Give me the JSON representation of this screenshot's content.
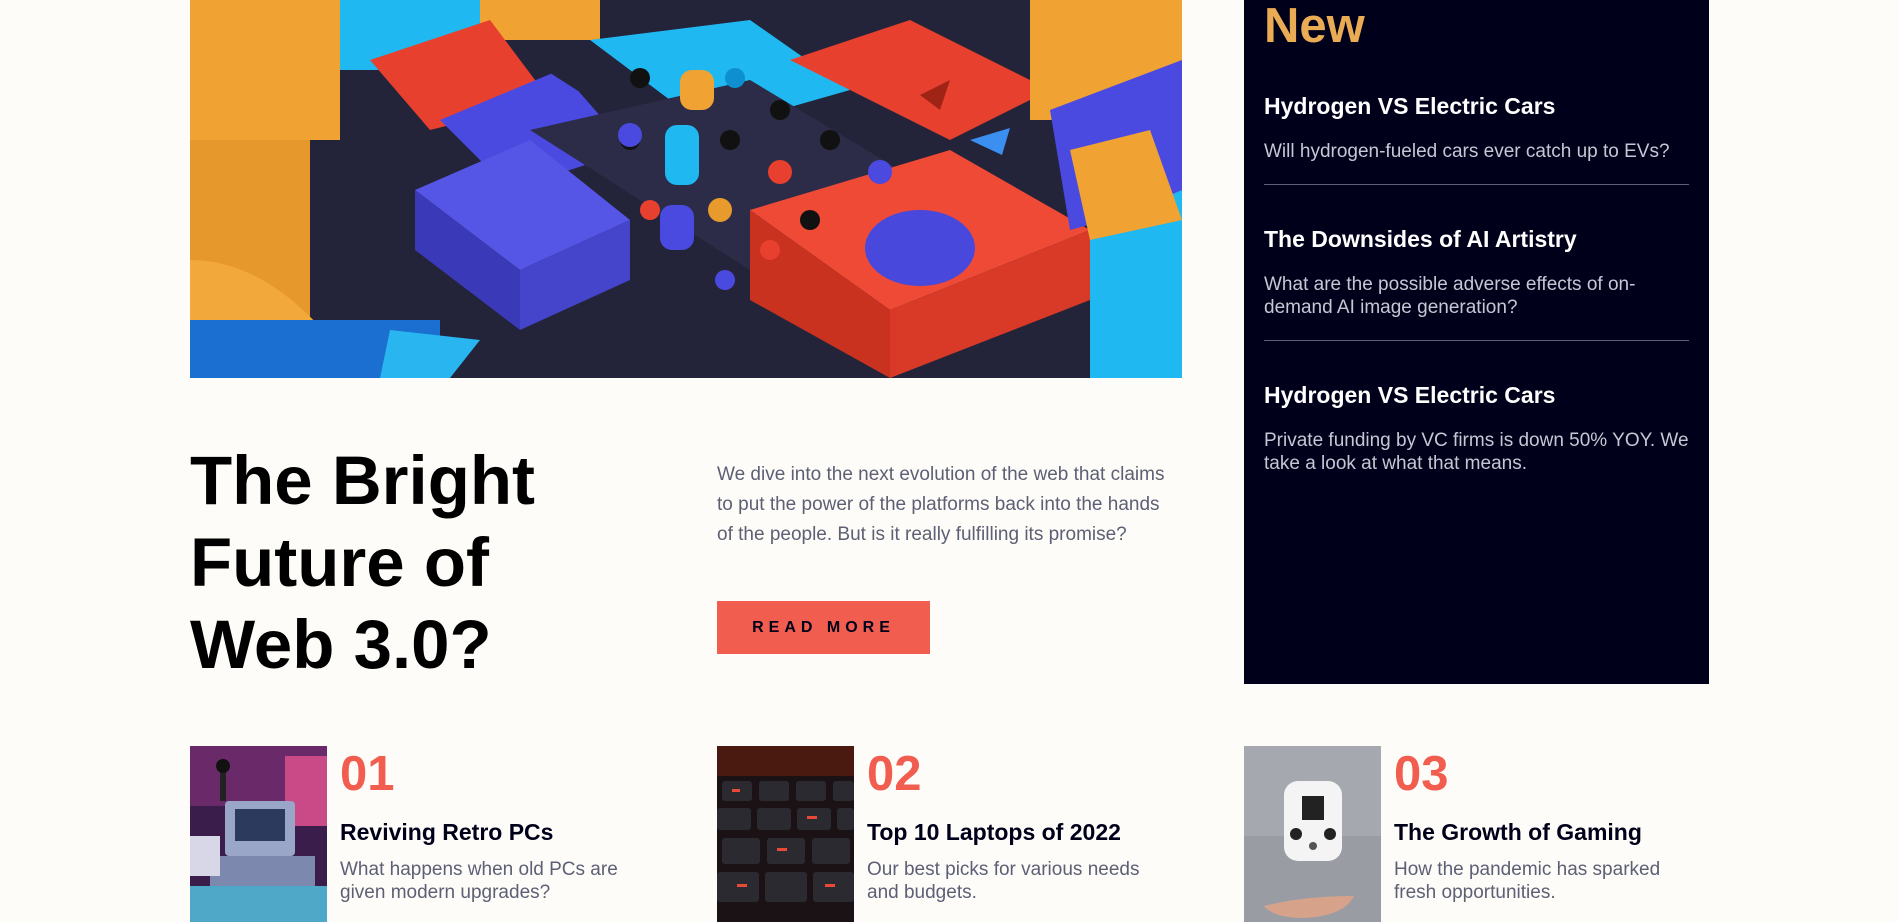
{
  "hero": {
    "headline": "The Bright Future of Web 3.0?",
    "intro": "We dive into the next evolution of the web that claims to put the power of the platforms back into the hands of the people. But is it really fulfilling its promise?",
    "cta_label": "READ MORE"
  },
  "new_panel": {
    "title": "New",
    "items": [
      {
        "title": "Hydrogen VS Electric Cars",
        "text": "Will hydrogen-fueled cars ever catch up to EVs?"
      },
      {
        "title": "The Downsides of AI Artistry",
        "text": "What are the possible adverse effects of on-demand AI image generation?"
      },
      {
        "title": "Hydrogen VS Electric Cars",
        "text": "Private funding by VC firms is down 50% YOY. We take a look at what that means."
      }
    ]
  },
  "numbered": [
    {
      "number": "01",
      "title": "Reviving Retro PCs",
      "text": "What happens when old PCs are given modern upgrades?"
    },
    {
      "number": "02",
      "title": "Top 10 Laptops of 2022",
      "text": "Our best picks for various needs and budgets."
    },
    {
      "number": "03",
      "title": "The Growth of Gaming",
      "text": "How the pandemic has sparked fresh opportunities."
    }
  ],
  "colors": {
    "background": "#fefcf8",
    "accent_red": "#f15d4e",
    "accent_orange": "#e9ab53",
    "dark_navy": "#00001a",
    "muted_text": "#5d6075"
  }
}
